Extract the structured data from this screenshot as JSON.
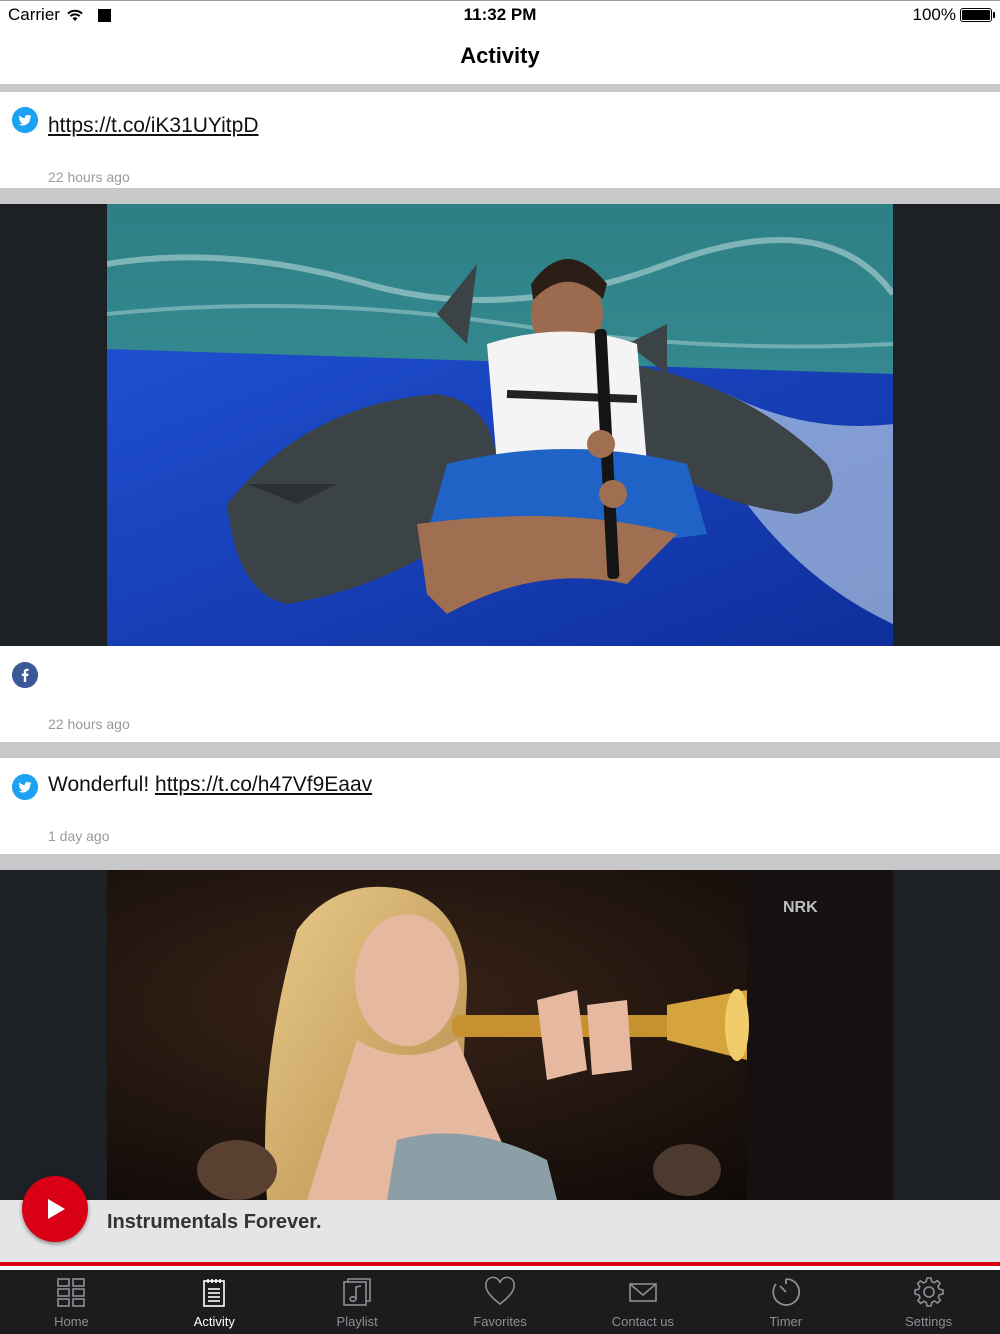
{
  "status_bar": {
    "carrier": "Carrier",
    "time": "11:32 PM",
    "battery": "100%"
  },
  "nav": {
    "title": "Activity"
  },
  "posts": [
    {
      "source": "twitter-icon",
      "text_prefix": "",
      "link": "https://t.co/iK31UYitpD",
      "time": "22 hours ago"
    },
    {
      "source": "facebook-icon",
      "text_prefix": "",
      "link": "",
      "time": "22 hours ago"
    },
    {
      "source": "twitter-icon",
      "text_prefix": "Wonderful!",
      "link": "https://t.co/h47Vf9Eaav",
      "time": "1 day ago"
    }
  ],
  "player": {
    "title": "Instrumentals Forever."
  },
  "tabs": [
    {
      "label": "Home",
      "icon": "grid-icon",
      "active": false
    },
    {
      "label": "Activity",
      "icon": "notepad-icon",
      "active": true
    },
    {
      "label": "Playlist",
      "icon": "music-note-icon",
      "active": false
    },
    {
      "label": "Favorites",
      "icon": "heart-icon",
      "active": false
    },
    {
      "label": "Contact us",
      "icon": "envelope-icon",
      "active": false
    },
    {
      "label": "Timer",
      "icon": "clock-icon",
      "active": false
    },
    {
      "label": "Settings",
      "icon": "gear-icon",
      "active": false
    }
  ],
  "colors": {
    "accent": "#d90016",
    "twitter": "#1da1f2",
    "facebook": "#3b5998",
    "tabbar": "#1c1c1e"
  }
}
